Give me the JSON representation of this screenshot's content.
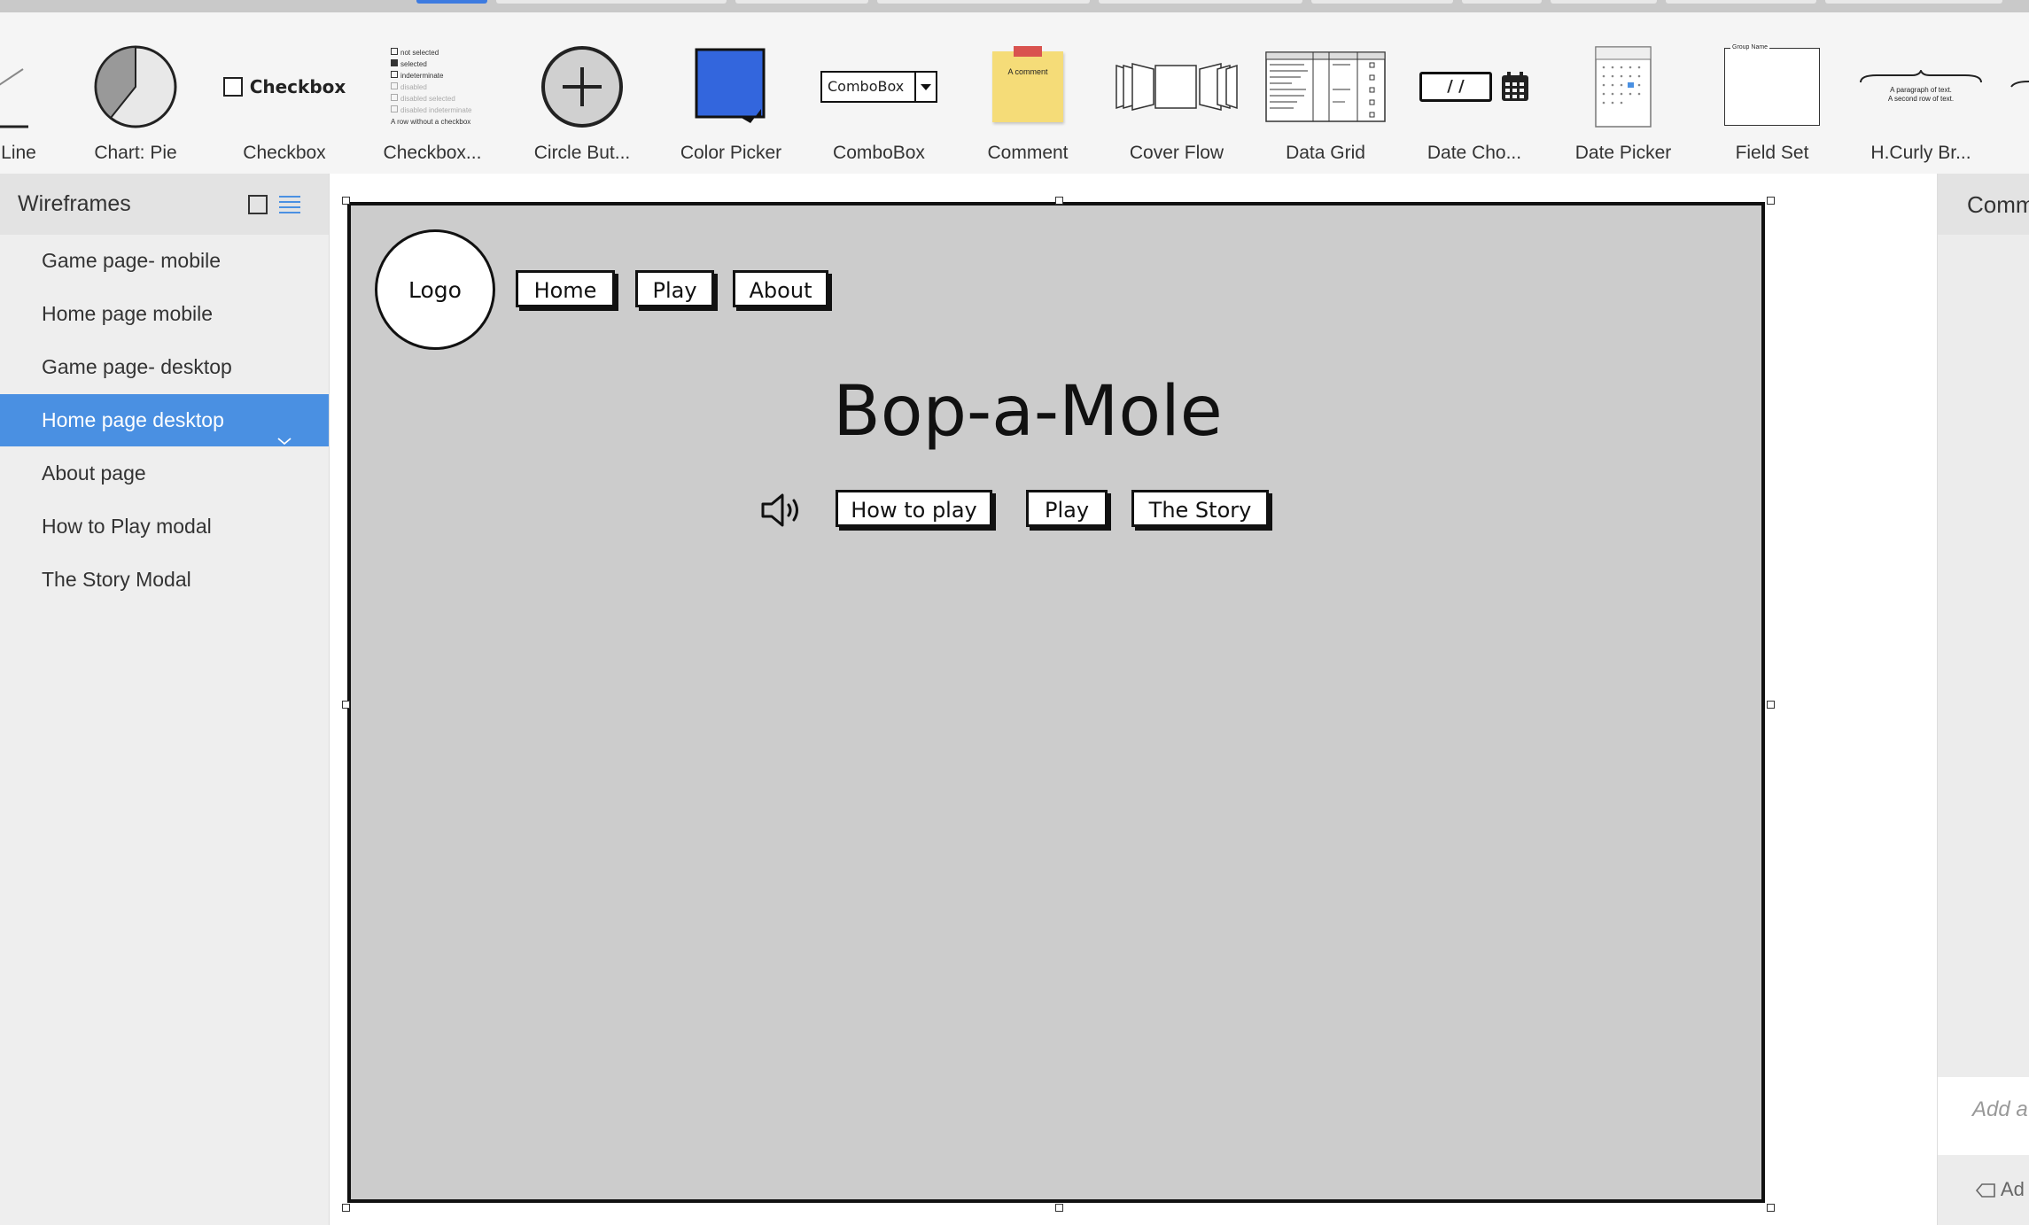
{
  "library": {
    "items": [
      {
        "label": "Line",
        "icon": "line-icon"
      },
      {
        "label": "Chart: Pie",
        "icon": "pie-chart-icon"
      },
      {
        "label": "Checkbox",
        "icon": "checkbox-icon",
        "icon_text": "Checkbox"
      },
      {
        "label": "Checkbox...",
        "icon": "checkbox-group-icon",
        "icon_lines": [
          "not selected",
          "selected",
          "indeterminate",
          "disabled",
          "disabled selected",
          "disabled indeterminate",
          "A row without a checkbox"
        ]
      },
      {
        "label": "Circle But...",
        "icon": "circle-plus-icon"
      },
      {
        "label": "Color Picker",
        "icon": "color-picker-icon"
      },
      {
        "label": "ComboBox",
        "icon": "combobox-icon",
        "icon_text": "ComboBox"
      },
      {
        "label": "Comment",
        "icon": "sticky-note-icon",
        "icon_text": "A comment"
      },
      {
        "label": "Cover Flow",
        "icon": "cover-flow-icon"
      },
      {
        "label": "Data Grid",
        "icon": "data-grid-icon"
      },
      {
        "label": "Date Cho...",
        "icon": "date-chooser-icon",
        "icon_text": "/ /"
      },
      {
        "label": "Date Picker",
        "icon": "date-picker-icon"
      },
      {
        "label": "Field Set",
        "icon": "field-set-icon",
        "icon_text": "Group Name"
      },
      {
        "label": "H.Curly Br...",
        "icon": "curly-brace-icon",
        "icon_lines": [
          "A paragraph of text.",
          "A second row of text."
        ]
      }
    ]
  },
  "sidebar": {
    "title": "Wireframes",
    "items": [
      {
        "label": "Game page- mobile",
        "selected": false
      },
      {
        "label": "Home page mobile",
        "selected": false
      },
      {
        "label": "Game page- desktop",
        "selected": false
      },
      {
        "label": "Home page desktop",
        "selected": true
      },
      {
        "label": "About page",
        "selected": false
      },
      {
        "label": "How to Play modal",
        "selected": false
      },
      {
        "label": "The Story Modal",
        "selected": false
      }
    ]
  },
  "wireframe": {
    "logo": "Logo",
    "nav": [
      "Home",
      "Play",
      "About"
    ],
    "title": "Bop-a-Mole",
    "actions": [
      "How to play",
      "Play",
      "The Story"
    ]
  },
  "comments": {
    "title": "Comm",
    "placeholder": "Add a",
    "tag_label": "Ad"
  },
  "colors": {
    "accent": "#4a90e2",
    "artboard": "#cccccc",
    "color_picker_blue": "#3366dd",
    "sticky_yellow": "#f5dc78"
  }
}
